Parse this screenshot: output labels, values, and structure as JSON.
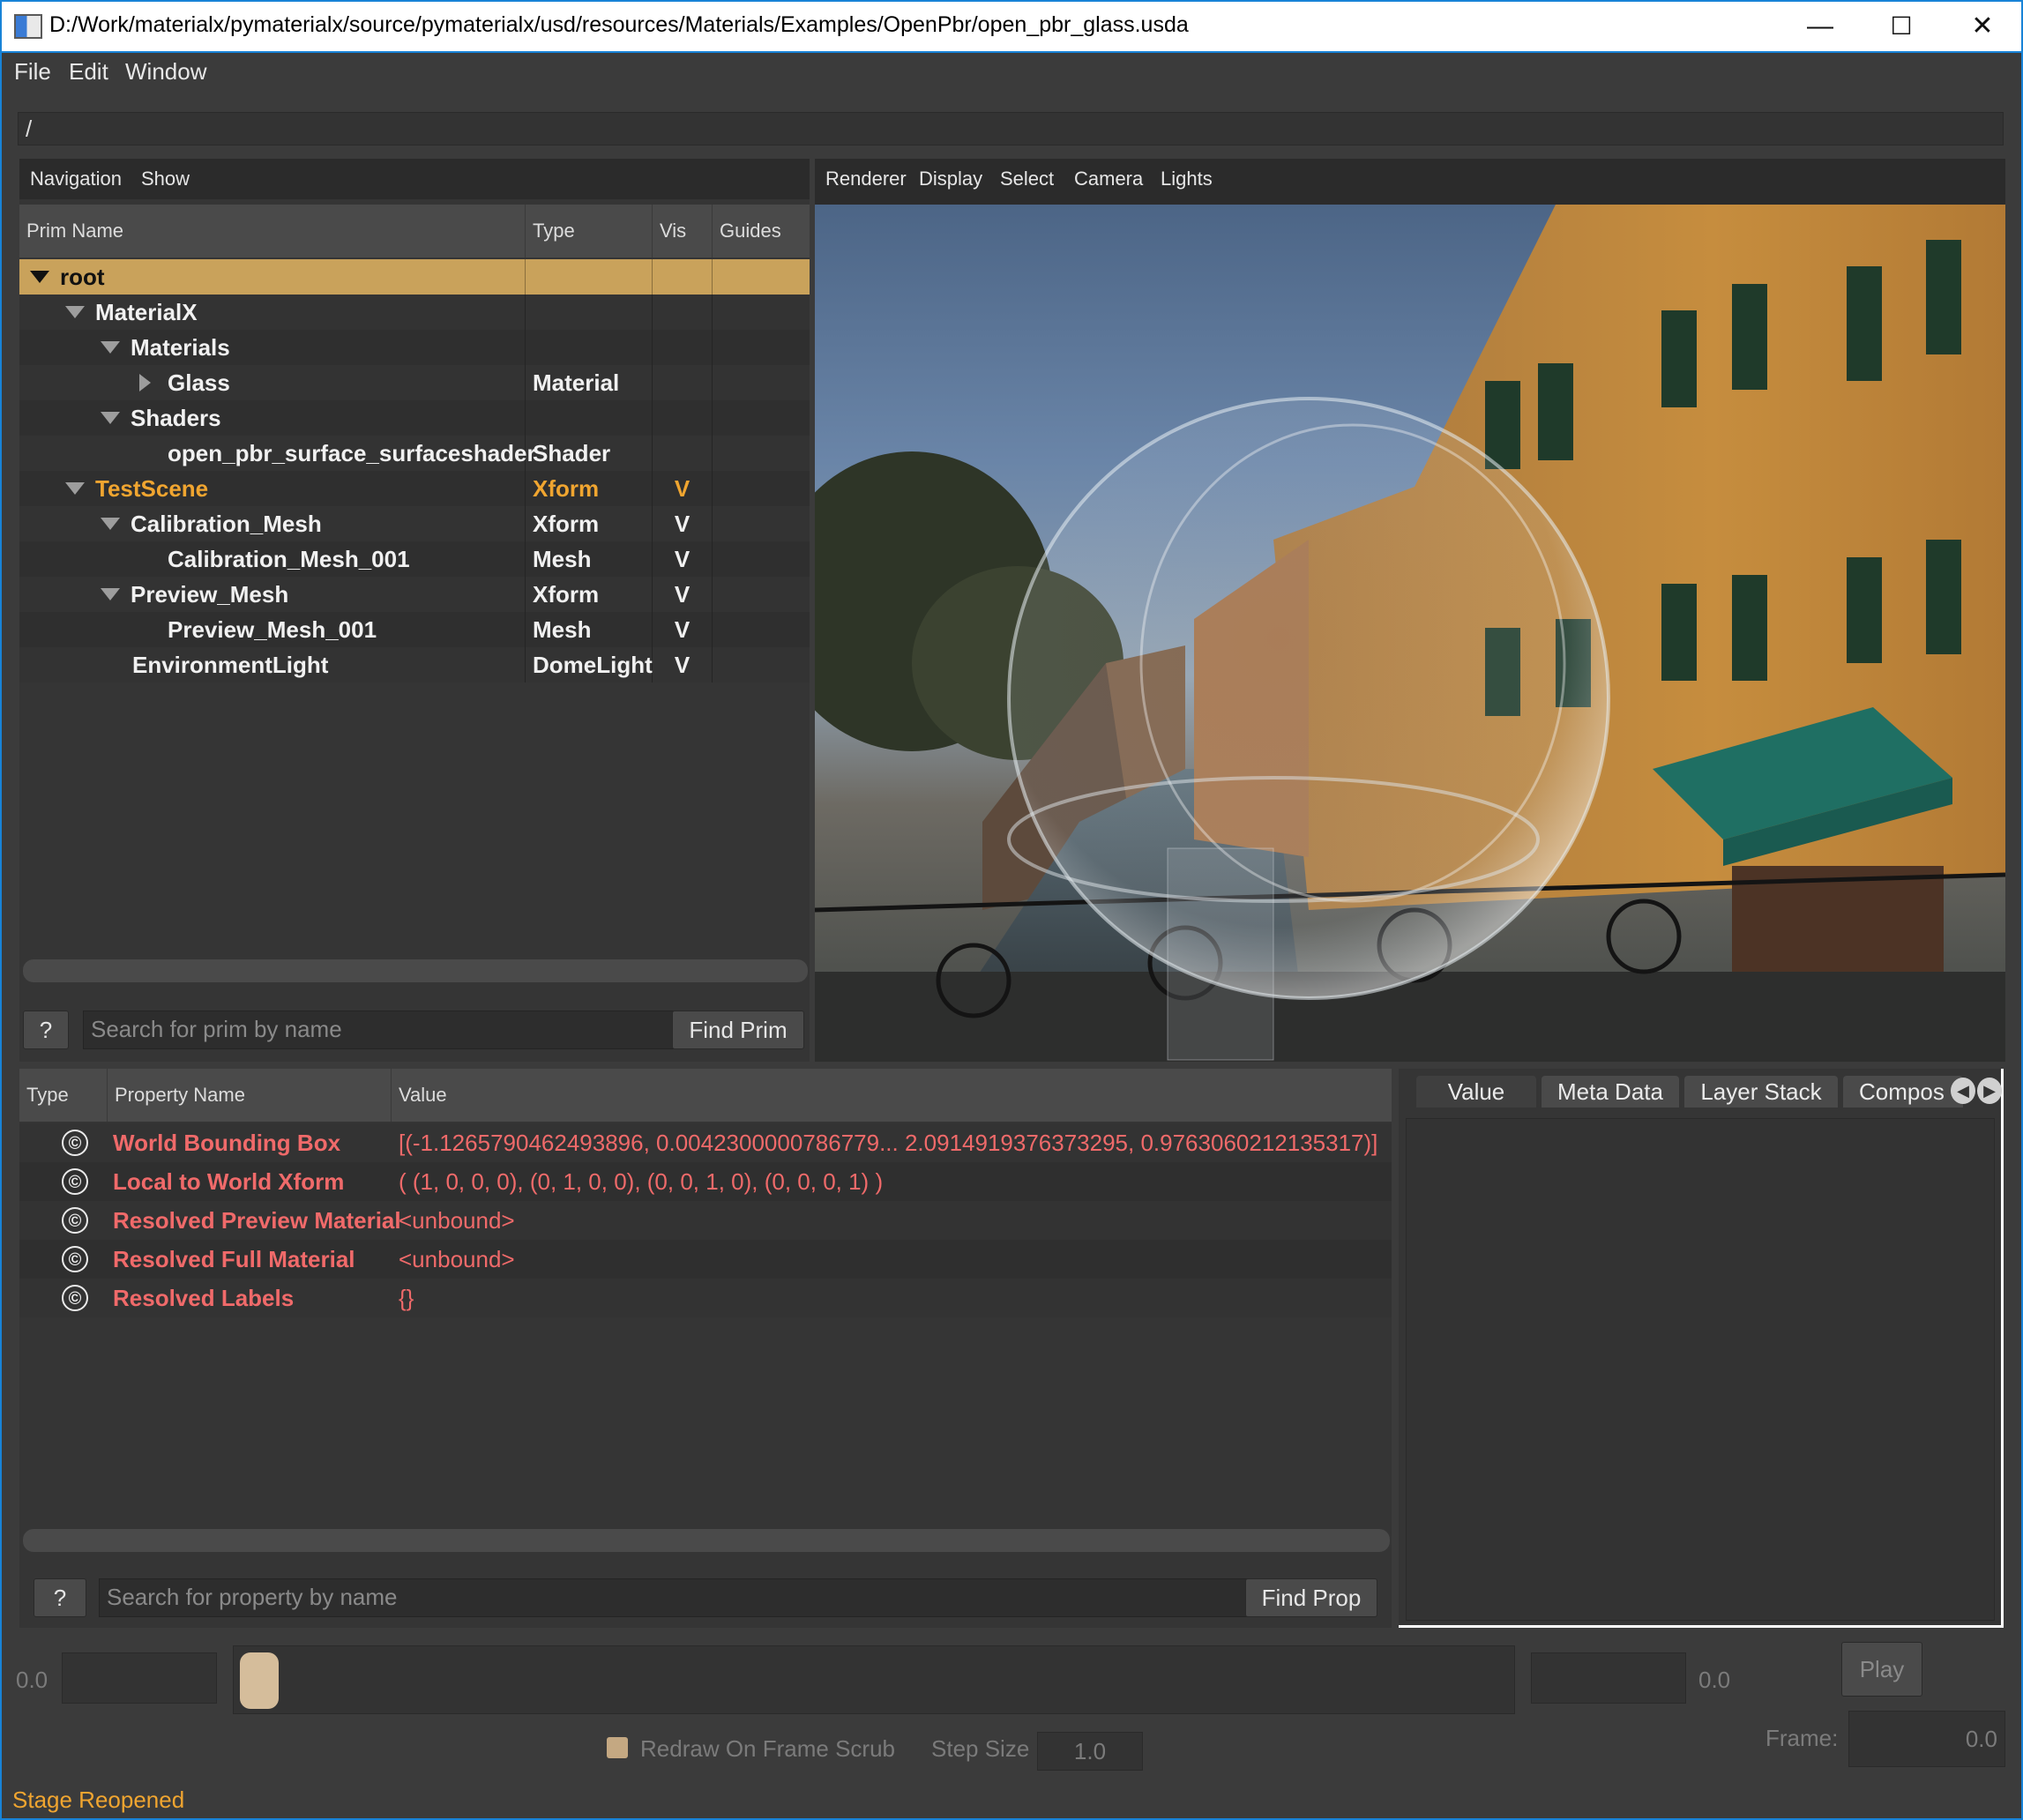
{
  "window": {
    "title": "D:/Work/materialx/pymaterialx/source/pymaterialx/usd/resources/Materials/Examples/OpenPbr/open_pbr_glass.usda",
    "minimize": "—",
    "maximize": "☐",
    "close": "✕"
  },
  "menu": [
    "File",
    "Edit",
    "Window"
  ],
  "path": "/",
  "prim_browser": {
    "toolbar": [
      "Navigation",
      "Show"
    ],
    "columns": [
      "Prim Name",
      "Type",
      "Vis",
      "Guides"
    ],
    "rows": [
      {
        "name": "root",
        "type": "",
        "vis": ""
      },
      {
        "name": "MaterialX",
        "type": "",
        "vis": ""
      },
      {
        "name": "Materials",
        "type": "",
        "vis": ""
      },
      {
        "name": "Glass",
        "type": "Material",
        "vis": ""
      },
      {
        "name": "Shaders",
        "type": "",
        "vis": ""
      },
      {
        "name": "open_pbr_surface_surfaceshader",
        "type": "Shader",
        "vis": ""
      },
      {
        "name": "TestScene",
        "type": "Xform",
        "vis": "V"
      },
      {
        "name": "Calibration_Mesh",
        "type": "Xform",
        "vis": "V"
      },
      {
        "name": "Calibration_Mesh_001",
        "type": "Mesh",
        "vis": "V"
      },
      {
        "name": "Preview_Mesh",
        "type": "Xform",
        "vis": "V"
      },
      {
        "name": "Preview_Mesh_001",
        "type": "Mesh",
        "vis": "V"
      },
      {
        "name": "EnvironmentLight",
        "type": "DomeLight",
        "vis": "V"
      }
    ],
    "help": "?",
    "search_placeholder": "Search for prim by name",
    "find_button": "Find Prim"
  },
  "viewport": {
    "toolbar": [
      "Renderer",
      "Display",
      "Select",
      "Camera",
      "Lights"
    ]
  },
  "property_browser": {
    "columns": [
      "Type",
      "Property Name",
      "Value"
    ],
    "rows": [
      {
        "icon": "©",
        "name": "World Bounding Box",
        "value": "[(-1.1265790462493896, 0.0042300000786779... 2.0914919376373295, 0.9763060212135317)]"
      },
      {
        "icon": "©",
        "name": "Local to World Xform",
        "value": "( (1, 0, 0, 0), (0, 1, 0, 0), (0, 0, 1, 0), (0, 0, 0, 1) )"
      },
      {
        "icon": "©",
        "name": "Resolved Preview Material",
        "value": "<unbound>"
      },
      {
        "icon": "©",
        "name": "Resolved Full Material",
        "value": "<unbound>"
      },
      {
        "icon": "©",
        "name": "Resolved Labels",
        "value": "{}"
      }
    ],
    "help": "?",
    "search_placeholder": "Search for property by name",
    "find_button": "Find Prop"
  },
  "side_tabs": [
    "Value",
    "Meta Data",
    "Layer Stack",
    "Compos"
  ],
  "timeline": {
    "start": "0.0",
    "end": "0.0",
    "play": "Play",
    "redraw_label": "Redraw On Frame Scrub",
    "step_label": "Step Size",
    "step_value": "1.0",
    "frame_label": "Frame:",
    "frame_value": "0.0"
  },
  "status": "Stage Reopened",
  "colors": {
    "accent_title": "#1883d7",
    "selection": "#c9a25b",
    "highlight_text": "#f0a530",
    "property_text": "#f06a6a"
  }
}
